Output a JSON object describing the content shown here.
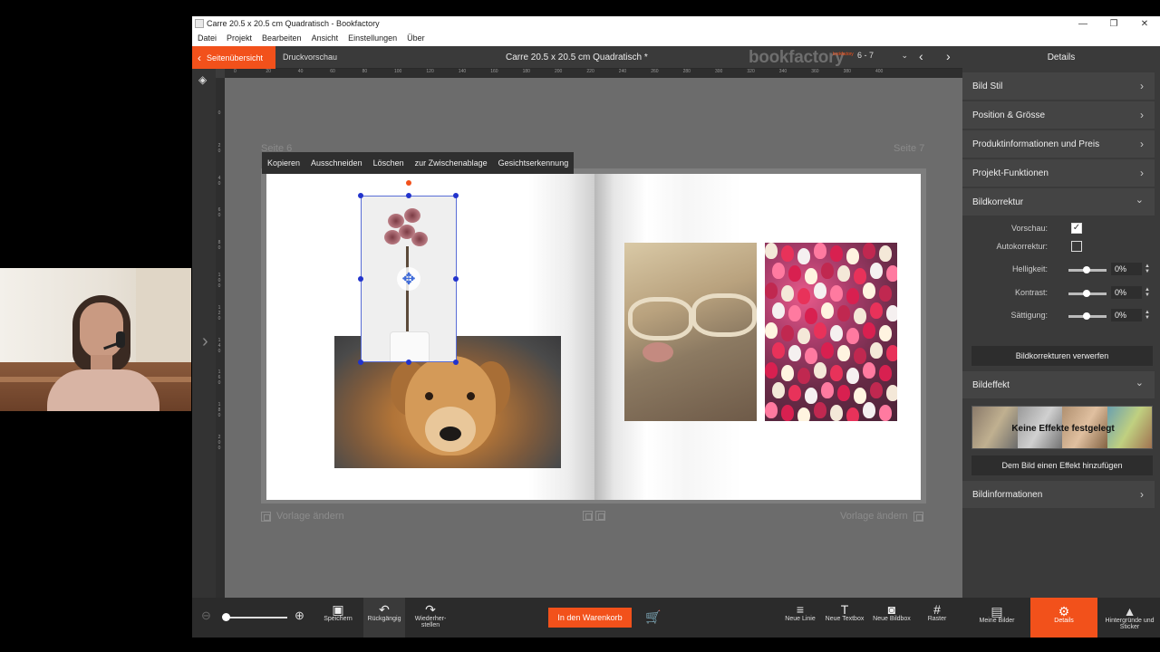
{
  "window": {
    "title": "Carre 20.5 x 20.5 cm Quadratisch - Bookfactory",
    "controls": {
      "minimize": "—",
      "maximize": "❐",
      "close": "✕"
    }
  },
  "menu": [
    "Datei",
    "Projekt",
    "Bearbeiten",
    "Ansicht",
    "Einstellungen",
    "Über"
  ],
  "topbar": {
    "overview_label": "Seitenübersicht",
    "print_preview_label": "Druckvorschau",
    "doc_title": "Carre 20.5 x 20.5 cm Quadratisch *",
    "logo": "bookfactory",
    "logo_small": "bookfactory",
    "page_select": "6 - 7",
    "details_title": "Details"
  },
  "ruler_h": [
    "0",
    "20",
    "40",
    "60",
    "80",
    "100",
    "120",
    "140",
    "160",
    "180",
    "200",
    "220",
    "240",
    "260",
    "280",
    "300",
    "320",
    "340",
    "360",
    "380",
    "400"
  ],
  "ruler_v": [
    "0",
    "20",
    "40",
    "60",
    "80",
    "100",
    "120",
    "140",
    "160",
    "180",
    "200"
  ],
  "canvas": {
    "page_left_label": "Seite 6",
    "page_right_label": "Seite 7",
    "layout_left": "Vorlage ändern",
    "layout_right": "Vorlage ändern"
  },
  "context_menu": [
    "Kopieren",
    "Ausschneiden",
    "Löschen",
    "zur Zwischenablage",
    "Gesichtserkennung"
  ],
  "panel": {
    "sections": {
      "bild_stil": "Bild Stil",
      "position": "Position & Grösse",
      "produkt": "Produktinformationen und Preis",
      "projekt": "Projekt-Funktionen",
      "bildkorrektur": "Bildkorrektur",
      "bildeffekt": "Bildeffekt",
      "bildinfo": "Bildinformationen"
    },
    "vorschau_label": "Vorschau:",
    "vorschau_checked": true,
    "autokorrektur_label": "Autokorrektur:",
    "autokorrektur_checked": false,
    "helligkeit_label": "Helligkeit:",
    "helligkeit_value": "0%",
    "kontrast_label": "Kontrast:",
    "kontrast_value": "0%",
    "saettigung_label": "Sättigung:",
    "saettigung_value": "0%",
    "discard_label": "Bildkorrekturen verwerfen",
    "effects_label": "Keine Effekte festgelegt",
    "add_effect_label": "Dem Bild einen Effekt hinzufügen"
  },
  "bottombar": {
    "save": "Speichern",
    "undo": "Rückgängig",
    "redo": "Wiederher-stellen",
    "cart": "In den Warenkorb",
    "new_line": "Neue Linie",
    "new_textbox": "Neue Textbox",
    "new_bildbox": "Neue Bildbox",
    "raster": "Raster",
    "meine_bilder": "Meine Bilder",
    "details": "Details",
    "hintergruende": "Hintergründe und Sticker"
  },
  "colors": {
    "accent": "#f2511b",
    "panel": "#3a3a3a",
    "canvas": "#6c6c6c"
  },
  "zoom_level": 0.0
}
